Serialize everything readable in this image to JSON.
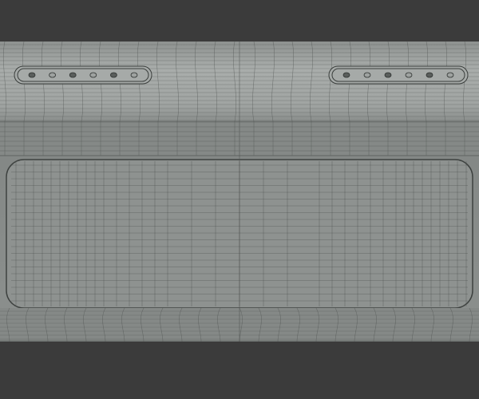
{
  "scene": {
    "background_color": "#3b3b3b",
    "top_band_color": "#a3a7a5",
    "front_color": "#8d918f",
    "wire_color": "#4a4e4c",
    "button_strip_count": 2,
    "buttons_per_strip": 6
  }
}
